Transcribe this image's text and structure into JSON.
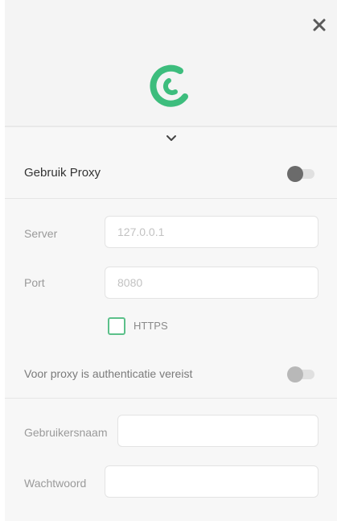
{
  "icons": {
    "close": "close-icon",
    "logo": "logo-icon",
    "expand": "chevron-down-icon"
  },
  "colors": {
    "accent": "#3dbd7d",
    "toggle_knob": "#6b6b6b",
    "checkbox_border": "#5cc08a"
  },
  "proxy": {
    "label": "Gebruik Proxy",
    "enabled": false
  },
  "server": {
    "label": "Server",
    "placeholder": "127.0.0.1"
  },
  "port": {
    "label": "Port",
    "placeholder": "8080"
  },
  "https": {
    "label": "HTTPS",
    "checked": false
  },
  "auth": {
    "label": "Voor proxy is authenticatie vereist",
    "enabled": false
  },
  "username": {
    "label": "Gebruikersnaam",
    "value": ""
  },
  "password": {
    "label": "Wachtwoord",
    "value": ""
  }
}
